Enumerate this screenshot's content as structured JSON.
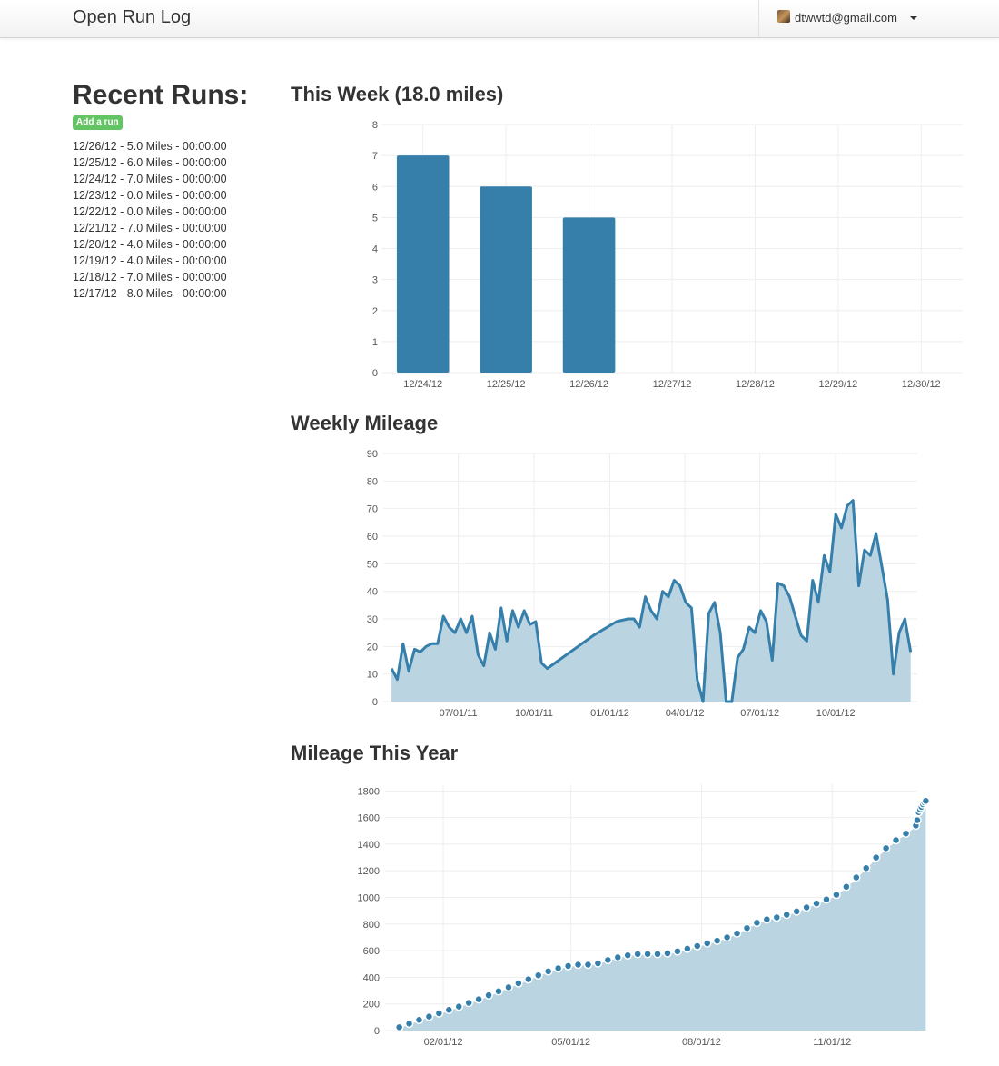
{
  "app": {
    "brand": "Open Run Log",
    "user_email": "dtwwtd@gmail.com"
  },
  "sidebar": {
    "title": "Recent Runs:",
    "add_run_label": "Add a run",
    "runs": [
      "12/26/12 - 5.0 Miles - 00:00:00",
      "12/25/12 - 6.0 Miles - 00:00:00",
      "12/24/12 - 7.0 Miles - 00:00:00",
      "12/23/12 - 0.0 Miles - 00:00:00",
      "12/22/12 - 0.0 Miles - 00:00:00",
      "12/21/12 - 7.0 Miles - 00:00:00",
      "12/20/12 - 4.0 Miles - 00:00:00",
      "12/19/12 - 4.0 Miles - 00:00:00",
      "12/18/12 - 7.0 Miles - 00:00:00",
      "12/17/12 - 8.0 Miles - 00:00:00"
    ]
  },
  "colors": {
    "bar": "#367fab",
    "line": "#367fab",
    "area": "#bad4e2",
    "grid": "#eeeeee",
    "add_run": "#62c462"
  },
  "chart_data": [
    {
      "type": "bar",
      "title": "This Week (18.0 miles)",
      "categories": [
        "12/24/12",
        "12/25/12",
        "12/26/12",
        "12/27/12",
        "12/28/12",
        "12/29/12",
        "12/30/12"
      ],
      "values": [
        7,
        6,
        5,
        0,
        0,
        0,
        0
      ],
      "ylim": [
        0,
        8
      ],
      "yticks": [
        0,
        1,
        2,
        3,
        4,
        5,
        6,
        7,
        8
      ],
      "grid": true
    },
    {
      "type": "area",
      "title": "Weekly Mileage",
      "xlim": [
        "2011-04-01",
        "2013-01-08"
      ],
      "xticks": [
        {
          "date": "2011-07-01",
          "label": "07/01/11"
        },
        {
          "date": "2011-10-01",
          "label": "10/01/11"
        },
        {
          "date": "2012-01-01",
          "label": "01/01/12"
        },
        {
          "date": "2012-04-01",
          "label": "04/01/12"
        },
        {
          "date": "2012-07-01",
          "label": "07/01/12"
        },
        {
          "date": "2012-10-01",
          "label": "10/01/12"
        }
      ],
      "ylim": [
        0,
        90
      ],
      "yticks": [
        0,
        10,
        20,
        30,
        40,
        50,
        60,
        70,
        80,
        90
      ],
      "grid": true,
      "series": [
        {
          "points": [
            [
              "2011-04-11",
              12
            ],
            [
              "2011-04-18",
              8
            ],
            [
              "2011-04-25",
              21
            ],
            [
              "2011-05-02",
              11
            ],
            [
              "2011-05-09",
              19
            ],
            [
              "2011-05-16",
              18
            ],
            [
              "2011-05-23",
              20
            ],
            [
              "2011-05-30",
              21
            ],
            [
              "2011-06-06",
              21
            ],
            [
              "2011-06-13",
              31
            ],
            [
              "2011-06-20",
              27
            ],
            [
              "2011-06-27",
              25
            ],
            [
              "2011-07-04",
              30
            ],
            [
              "2011-07-11",
              25
            ],
            [
              "2011-07-18",
              31
            ],
            [
              "2011-07-25",
              17
            ],
            [
              "2011-08-01",
              13
            ],
            [
              "2011-08-08",
              25
            ],
            [
              "2011-08-15",
              19
            ],
            [
              "2011-08-22",
              34
            ],
            [
              "2011-08-29",
              22
            ],
            [
              "2011-09-05",
              33
            ],
            [
              "2011-09-12",
              27
            ],
            [
              "2011-09-19",
              33
            ],
            [
              "2011-09-26",
              28
            ],
            [
              "2011-10-03",
              29
            ],
            [
              "2011-10-10",
              14
            ],
            [
              "2011-10-17",
              12
            ],
            [
              "2011-11-14",
              18
            ],
            [
              "2011-12-12",
              24
            ],
            [
              "2012-01-09",
              29
            ],
            [
              "2012-01-23",
              30
            ],
            [
              "2012-01-30",
              30
            ],
            [
              "2012-02-06",
              27
            ],
            [
              "2012-02-13",
              38
            ],
            [
              "2012-02-20",
              33
            ],
            [
              "2012-02-27",
              30
            ],
            [
              "2012-03-05",
              40
            ],
            [
              "2012-03-12",
              38
            ],
            [
              "2012-03-19",
              44
            ],
            [
              "2012-03-26",
              42
            ],
            [
              "2012-04-02",
              36
            ],
            [
              "2012-04-09",
              34
            ],
            [
              "2012-04-16",
              8
            ],
            [
              "2012-04-23",
              0
            ],
            [
              "2012-04-30",
              32
            ],
            [
              "2012-05-07",
              36
            ],
            [
              "2012-05-14",
              25
            ],
            [
              "2012-05-21",
              0
            ],
            [
              "2012-05-28",
              0
            ],
            [
              "2012-06-04",
              16
            ],
            [
              "2012-06-11",
              19
            ],
            [
              "2012-06-18",
              27
            ],
            [
              "2012-06-25",
              25
            ],
            [
              "2012-07-02",
              33
            ],
            [
              "2012-07-09",
              29
            ],
            [
              "2012-07-16",
              15
            ],
            [
              "2012-07-23",
              43
            ],
            [
              "2012-07-30",
              42
            ],
            [
              "2012-08-06",
              38
            ],
            [
              "2012-08-13",
              31
            ],
            [
              "2012-08-20",
              24
            ],
            [
              "2012-08-27",
              22
            ],
            [
              "2012-09-03",
              44
            ],
            [
              "2012-09-10",
              36
            ],
            [
              "2012-09-17",
              53
            ],
            [
              "2012-09-24",
              47
            ],
            [
              "2012-10-01",
              68
            ],
            [
              "2012-10-08",
              63
            ],
            [
              "2012-10-15",
              71
            ],
            [
              "2012-10-22",
              73
            ],
            [
              "2012-10-29",
              42
            ],
            [
              "2012-11-05",
              55
            ],
            [
              "2012-11-12",
              53
            ],
            [
              "2012-11-19",
              61
            ],
            [
              "2012-11-26",
              49
            ],
            [
              "2012-12-03",
              37
            ],
            [
              "2012-12-10",
              10
            ],
            [
              "2012-12-17",
              25
            ],
            [
              "2012-12-24",
              30
            ],
            [
              "2012-12-31",
              18
            ]
          ]
        }
      ]
    },
    {
      "type": "area",
      "title": "Mileage This Year",
      "xlim": [
        "2011-12-22",
        "2012-12-31"
      ],
      "xticks": [
        {
          "date": "2012-02-01",
          "label": "02/01/12"
        },
        {
          "date": "2012-05-01",
          "label": "05/01/12"
        },
        {
          "date": "2012-08-01",
          "label": "08/01/12"
        },
        {
          "date": "2012-11-01",
          "label": "11/01/12"
        }
      ],
      "ylim": [
        0,
        1850
      ],
      "yticks": [
        0,
        200,
        400,
        600,
        800,
        1000,
        1200,
        1400,
        1600,
        1800
      ],
      "grid": true,
      "series": [
        {
          "points": [
            [
              "2012-01-01",
              25
            ],
            [
              "2012-01-08",
              52
            ],
            [
              "2012-01-15",
              80
            ],
            [
              "2012-01-22",
              105
            ],
            [
              "2012-01-29",
              130
            ],
            [
              "2012-02-05",
              155
            ],
            [
              "2012-02-12",
              180
            ],
            [
              "2012-02-19",
              208
            ],
            [
              "2012-02-26",
              235
            ],
            [
              "2012-03-04",
              265
            ],
            [
              "2012-03-11",
              295
            ],
            [
              "2012-03-18",
              325
            ],
            [
              "2012-03-25",
              355
            ],
            [
              "2012-04-01",
              385
            ],
            [
              "2012-04-08",
              415
            ],
            [
              "2012-04-15",
              445
            ],
            [
              "2012-04-22",
              468
            ],
            [
              "2012-04-29",
              485
            ],
            [
              "2012-05-06",
              495
            ],
            [
              "2012-05-13",
              495
            ],
            [
              "2012-05-20",
              505
            ],
            [
              "2012-05-27",
              530
            ],
            [
              "2012-06-03",
              550
            ],
            [
              "2012-06-10",
              565
            ],
            [
              "2012-06-17",
              575
            ],
            [
              "2012-06-24",
              575
            ],
            [
              "2012-07-01",
              575
            ],
            [
              "2012-07-08",
              580
            ],
            [
              "2012-07-15",
              595
            ],
            [
              "2012-07-22",
              615
            ],
            [
              "2012-07-29",
              635
            ],
            [
              "2012-08-05",
              655
            ],
            [
              "2012-08-12",
              675
            ],
            [
              "2012-08-19",
              700
            ],
            [
              "2012-08-26",
              730
            ],
            [
              "2012-09-02",
              770
            ],
            [
              "2012-09-09",
              810
            ],
            [
              "2012-09-16",
              835
            ],
            [
              "2012-09-23",
              850
            ],
            [
              "2012-09-30",
              870
            ],
            [
              "2012-10-07",
              895
            ],
            [
              "2012-10-14",
              925
            ],
            [
              "2012-10-21",
              955
            ],
            [
              "2012-10-28",
              985
            ],
            [
              "2012-11-04",
              1020
            ],
            [
              "2012-11-11",
              1080
            ],
            [
              "2012-11-18",
              1150
            ],
            [
              "2012-11-25",
              1220
            ],
            [
              "2012-12-02",
              1300
            ],
            [
              "2012-12-09",
              1370
            ],
            [
              "2012-12-16",
              1430
            ],
            [
              "2012-12-23",
              1480
            ],
            [
              "2012-12-30",
              1540
            ],
            [
              "2012-12-31",
              1580
            ],
            [
              "2013-01-01",
              1640
            ],
            [
              "2013-01-02",
              1660
            ],
            [
              "2013-01-03",
              1680
            ],
            [
              "2013-01-04",
              1700
            ],
            [
              "2013-01-05",
              1715
            ],
            [
              "2013-01-06",
              1725
            ]
          ]
        }
      ]
    }
  ]
}
